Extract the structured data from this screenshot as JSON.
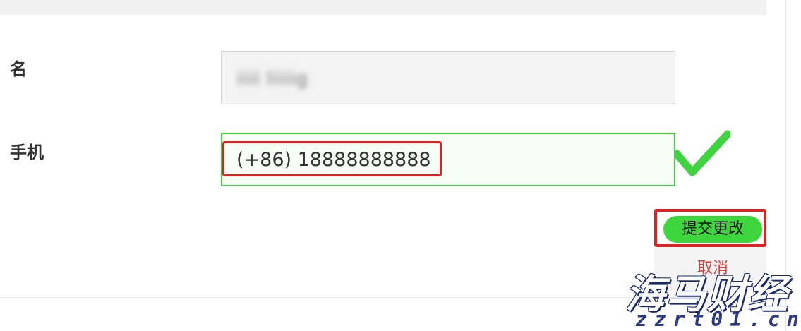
{
  "form": {
    "name_label": "名",
    "name_value": "iiii liiiig",
    "phone_label": "手机",
    "phone_value": "(+86) 18888888888",
    "submit_label": "提交更改",
    "cancel_label": "取消"
  },
  "icons": {
    "valid": "checkmark-icon"
  },
  "watermark": {
    "title": "海马财经",
    "url": "zzrt01.cn"
  },
  "colors": {
    "valid_green": "#3fd43f",
    "highlight_red": "#e02121",
    "submit_green": "#3dd63d",
    "watermark_blue": "#2b3a87"
  }
}
